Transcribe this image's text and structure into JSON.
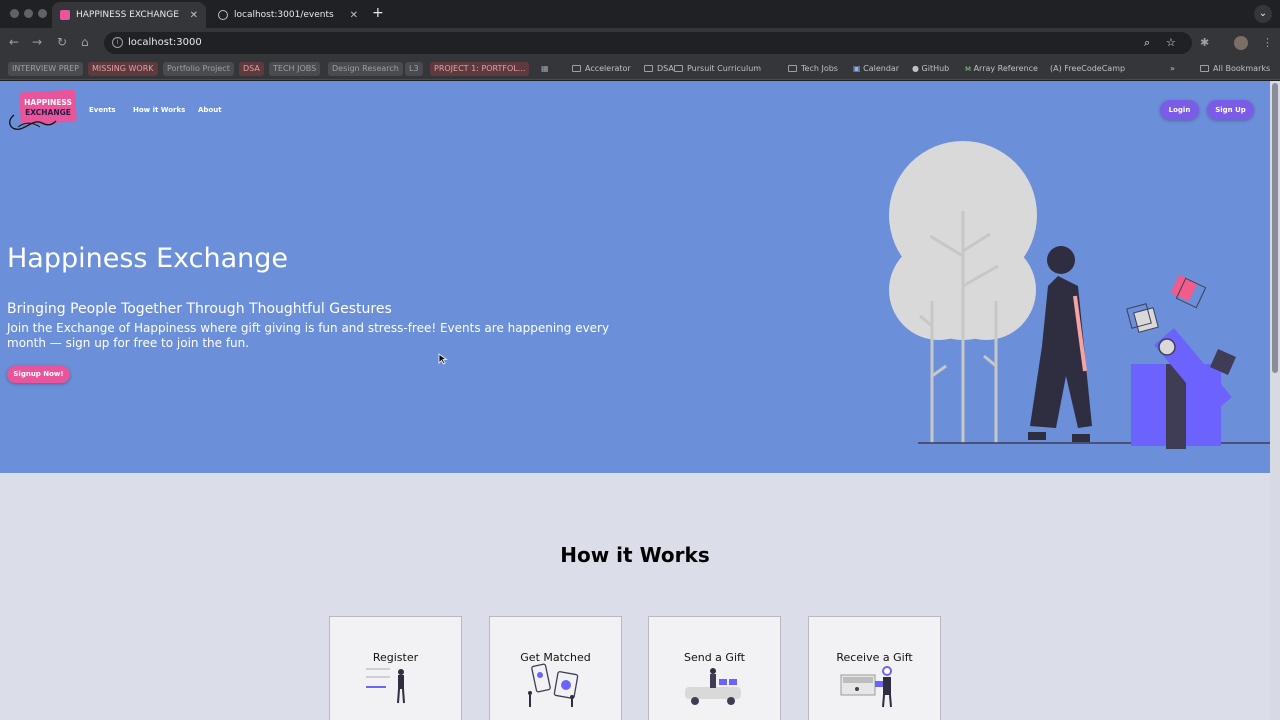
{
  "browser": {
    "tabs": [
      {
        "title": "HAPPINESS EXCHANGE",
        "active": true
      },
      {
        "title": "localhost:3001/events",
        "active": false
      }
    ],
    "new_tab": "+",
    "address": "localhost:3000",
    "bookmarks": [
      {
        "label": "INTERVIEW PREP",
        "style": "tag"
      },
      {
        "label": "MISSING WORK",
        "style": "red"
      },
      {
        "label": "Portfolio Project",
        "style": "tag"
      },
      {
        "label": "DSA",
        "style": "red"
      },
      {
        "label": "TECH JOBS",
        "style": "tag"
      },
      {
        "label": "Design Research",
        "style": "tag"
      },
      {
        "label": "L3",
        "style": "tag"
      },
      {
        "label": "PROJECT 1: PORTFOL...",
        "style": "red"
      },
      {
        "label": "Accelerator",
        "style": "folder"
      },
      {
        "label": "DSA",
        "style": "folder"
      },
      {
        "label": "Pursuit Curriculum",
        "style": "folder"
      },
      {
        "label": "Tech Jobs",
        "style": "folder"
      },
      {
        "label": "Calendar",
        "style": "link"
      },
      {
        "label": "GitHub",
        "style": "link"
      },
      {
        "label": "Array Reference",
        "style": "link"
      },
      {
        "label": "FreeCodeCamp",
        "style": "link"
      }
    ],
    "more_bookmarks": "»",
    "all_bookmarks": "All Bookmarks"
  },
  "site": {
    "logo": {
      "line1": "HAPPINESS",
      "line2": "EXCHANGE"
    },
    "nav": [
      "Events",
      "How it Works",
      "About"
    ],
    "login": "Login",
    "signup": "Sign Up",
    "colors": {
      "hero": "#6b8fd9",
      "accent": "#e9559b",
      "button": "#7b5ce6",
      "section": "#dbdde8"
    }
  },
  "hero": {
    "title": "Happiness Exchange",
    "subtitle": "Bringing People Together Through Thoughtful Gestures",
    "description": "Join the Exchange of Happiness where gift giving is fun and stress-free! Events are happening every month — sign up for free to join the fun.",
    "cta": "Signup Now!"
  },
  "how_it_works": {
    "title": "How it Works",
    "steps": [
      "Register",
      "Get Matched",
      "Send a Gift",
      "Receive a Gift"
    ]
  }
}
